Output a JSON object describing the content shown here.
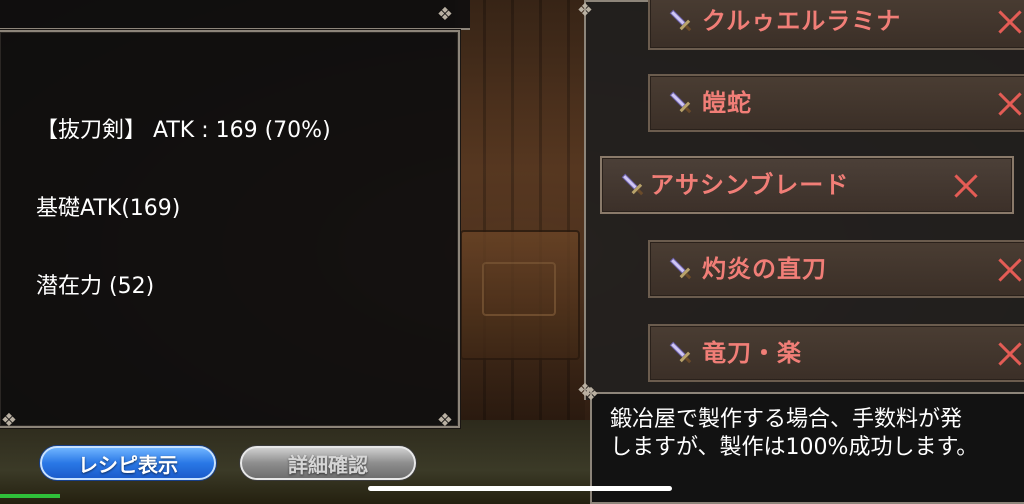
{
  "info_panel": {
    "lines": [
      "【抜刀剣】 ATK : 169 (70%)",
      "基礎ATK(169)",
      "潜在力 (52)"
    ]
  },
  "buttons": {
    "recipe_label": "レシピ表示",
    "detail_label": "詳細確認"
  },
  "weapon_list": [
    {
      "name": "クルゥエルラミナ",
      "icon": "sword-icon",
      "selected": false
    },
    {
      "name": "皚蛇",
      "icon": "sword-icon",
      "selected": false
    },
    {
      "name": "アサシンブレード",
      "icon": "sword-icon",
      "selected": true
    },
    {
      "name": "灼炎の直刀",
      "icon": "sword-icon",
      "selected": false
    },
    {
      "name": "竜刀・楽",
      "icon": "sword-icon",
      "selected": false
    }
  ],
  "message": {
    "line1": "鍛冶屋で製作する場合、手数料が発",
    "line2": "しますが、製作は100%成功します。"
  },
  "colors": {
    "item_name": "#f17e77",
    "remove_x": "#e45c55",
    "recipe_button": "#2a78e6",
    "detail_button": "#8e8e8e"
  }
}
